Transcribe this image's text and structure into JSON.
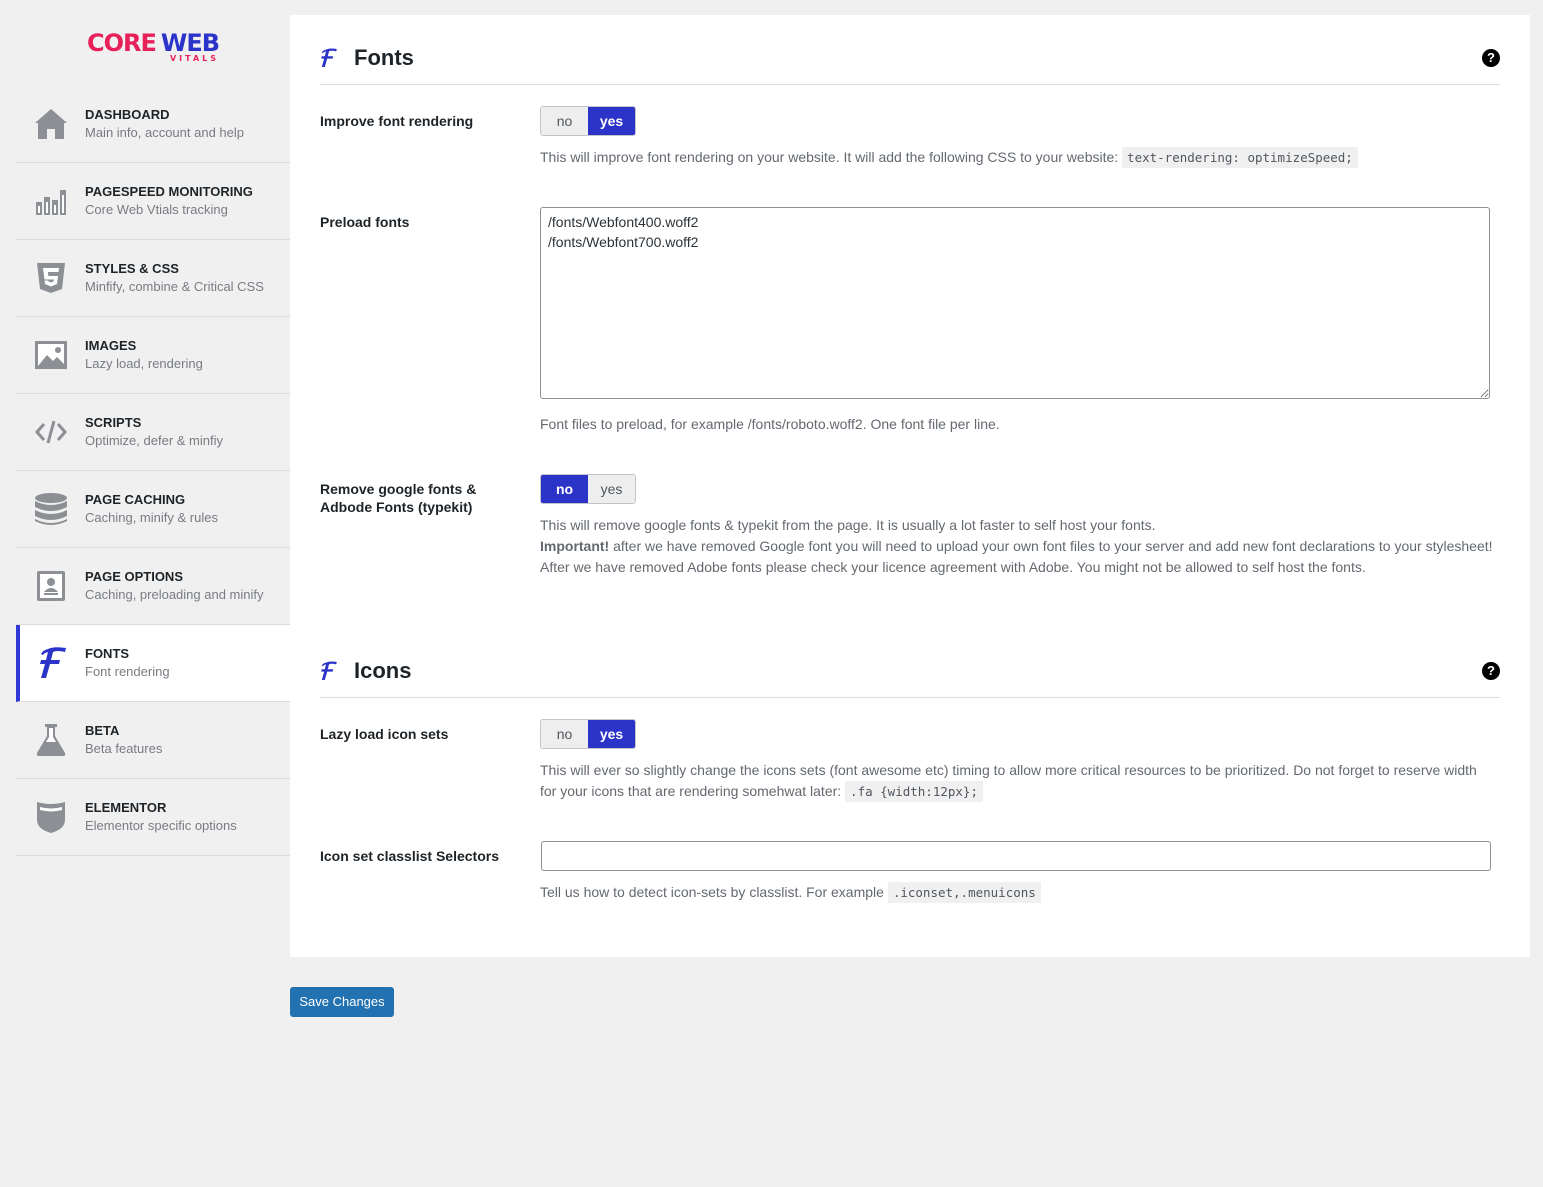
{
  "logo": {
    "core": "CORE",
    "web": "WEB",
    "sub": "VITALS"
  },
  "sidebar": {
    "items": [
      {
        "title": "DASHBOARD",
        "sub": "Main info, account and help",
        "icon": "home-icon"
      },
      {
        "title": "PAGESPEED MONITORING",
        "sub": "Core Web Vtials tracking",
        "icon": "bar-chart-icon"
      },
      {
        "title": "STYLES & CSS",
        "sub": "Minfify, combine & Critical CSS",
        "icon": "css3-icon"
      },
      {
        "title": "IMAGES",
        "sub": "Lazy load, rendering",
        "icon": "image-icon"
      },
      {
        "title": "SCRIPTS",
        "sub": "Optimize, defer & minfiy",
        "icon": "code-icon"
      },
      {
        "title": "PAGE CACHING",
        "sub": "Caching, minify & rules",
        "icon": "database-icon"
      },
      {
        "title": "PAGE OPTIONS",
        "sub": "Caching, preloading and minify",
        "icon": "page-options-icon"
      },
      {
        "title": "FONTS",
        "sub": "Font rendering",
        "icon": "font-icon",
        "active": true
      },
      {
        "title": "BETA",
        "sub": "Beta features",
        "icon": "flask-icon"
      },
      {
        "title": "ELEMENTOR",
        "sub": "Elementor specific options",
        "icon": "elementor-icon"
      }
    ]
  },
  "fonts_section": {
    "title": "Fonts",
    "help": "?",
    "improve": {
      "label": "Improve font rendering",
      "no": "no",
      "yes": "yes",
      "selected": "yes",
      "desc": "This will improve font rendering on your website. It will add the following CSS to your website:",
      "code": "text-rendering: optimizeSpeed;"
    },
    "preload": {
      "label": "Preload fonts",
      "value": "/fonts/Webfont400.woff2\n/fonts/Webfont700.woff2",
      "desc": "Font files to preload, for example /fonts/roboto.woff2. One font file per line."
    },
    "remove_google": {
      "label": "Remove google fonts & Adbode Fonts (typekit)",
      "no": "no",
      "yes": "yes",
      "selected": "no",
      "desc1": "This will remove google fonts & typekit from the page. It is usually a lot faster to self host your fonts.",
      "important": "Important!",
      "desc2": " after we have removed Google font you will need to upload your own font files to your server and add new font declarations to your stylesheet!",
      "desc3": "After we have removed Adobe fonts please check your licence agreement with Adobe. You might not be allowed to self host the fonts."
    }
  },
  "icons_section": {
    "title": "Icons",
    "help": "?",
    "lazy": {
      "label": "Lazy load icon sets",
      "no": "no",
      "yes": "yes",
      "selected": "yes",
      "desc": "This will ever so slightly change the icons sets (font awesome etc) timing to allow more critical resources to be prioritized. Do not forget to reserve width for your icons that are rendering somehwat later:",
      "code": ".fa {width:12px};"
    },
    "selectors": {
      "label": "Icon set classlist Selectors",
      "value": "",
      "desc": "Tell us how to detect icon-sets by classlist. For example",
      "code": ".iconset,.menuicons"
    }
  },
  "save_button": "Save Changes",
  "colors": {
    "accent": "#2c33c9",
    "brand_pink": "#e8205a",
    "wp_blue": "#2271b1"
  }
}
